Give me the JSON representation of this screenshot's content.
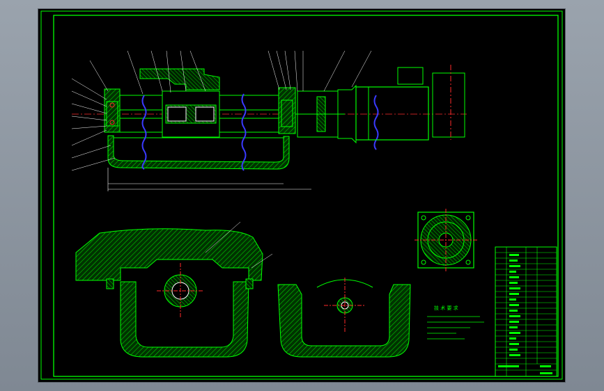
{
  "drawing": {
    "colors": {
      "background": "#000000",
      "frame": "#00ff00",
      "outline": "#00ff00",
      "hatch": "#00cc00",
      "spring": "#3a3aff",
      "centerline": "#ff2a2a",
      "dimension": "#ffffff",
      "window": "#8e979f"
    },
    "icons": {
      "motor": "motor-icon",
      "ball-screw": "ball-screw-icon",
      "bearing": "bearing-icon"
    },
    "notes_title": "技 术 要 求"
  }
}
